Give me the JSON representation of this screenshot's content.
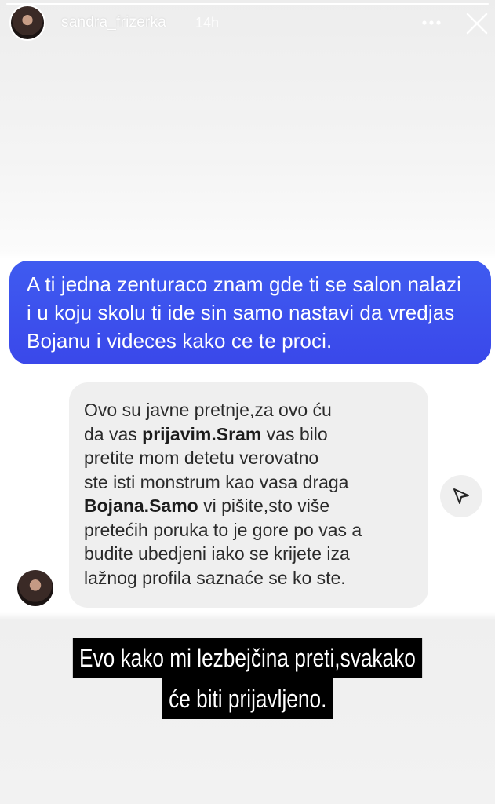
{
  "story": {
    "username": "sandra_frizerka",
    "time": "14h",
    "progress_fraction": 1.0,
    "icons": {
      "more": "more-horizontal-icon",
      "close": "close-icon",
      "share": "send-icon"
    }
  },
  "sent_message": {
    "lines": [
      "A ti jedna zenturaco znam gde ti se salon nalazi",
      "i u koju skolu ti ide sin samo nastavi da vredjas",
      "Bojanu i videces kako ce te proci."
    ]
  },
  "reply_message": {
    "line1": "Ovo su javne pretnje,za ovo ću",
    "line2_a": "da vas ",
    "line2_b": "prijavim.Sram",
    "line2_c": " vas bilo",
    "line3": "pretite mom detetu verovatno",
    "line4": "ste isti monstrum kao vasa draga",
    "line5_b": "Bojana.Samo",
    "line5_c": " vi pišite,sto više",
    "line6": "pretećih poruka to je gore po vas a",
    "line7": "budite ubedjeni iako se krijete iza",
    "line8": "lažnog profila saznaće se ko ste."
  },
  "caption": {
    "line1": "Evo kako mi lezbejčina preti,svakako",
    "line2": "će biti prijavljeno."
  }
}
